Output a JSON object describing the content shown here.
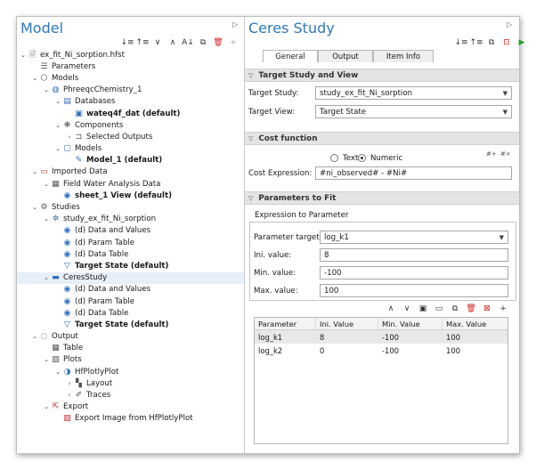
{
  "left": {
    "title": "Model",
    "tree": [
      {
        "indent": 0,
        "caret": "v",
        "icon": "file-icon",
        "glyph": "🗎",
        "label": "ex_fit_Ni_sorption.hfst",
        "bold": false
      },
      {
        "indent": 1,
        "caret": "",
        "icon": "list-icon",
        "glyph": "☰",
        "label": "Parameters",
        "bold": false
      },
      {
        "indent": 1,
        "caret": "v",
        "icon": "cube-icon",
        "glyph": "⬡",
        "label": "Models",
        "bold": false
      },
      {
        "indent": 2,
        "caret": "v",
        "icon": "phreeqc-icon",
        "glyph": "◍",
        "label": "PhreeqcChemistry_1",
        "bold": false
      },
      {
        "indent": 3,
        "caret": "v",
        "icon": "database-icon",
        "glyph": "▤",
        "label": "Databases",
        "bold": false
      },
      {
        "indent": 4,
        "caret": "",
        "icon": "dat-file-icon",
        "glyph": "▣",
        "label": "wateq4f_dat (default)",
        "bold": true
      },
      {
        "indent": 3,
        "caret": "v",
        "icon": "components-icon",
        "glyph": "❋",
        "label": "Components",
        "bold": false
      },
      {
        "indent": 4,
        "caret": ">",
        "icon": "cart-icon",
        "glyph": "⊐",
        "label": "Selected Outputs",
        "bold": false
      },
      {
        "indent": 3,
        "caret": "v",
        "icon": "models-icon",
        "glyph": "▢",
        "label": "Models",
        "bold": false
      },
      {
        "indent": 4,
        "caret": "",
        "icon": "model-edit-icon",
        "glyph": "✎",
        "label": "Model_1 (default)",
        "bold": true
      },
      {
        "indent": 1,
        "caret": "v",
        "icon": "folder-icon",
        "glyph": "▭",
        "label": "Imported Data",
        "bold": false
      },
      {
        "indent": 2,
        "caret": "v",
        "icon": "table-icon",
        "glyph": "▦",
        "label": "Field Water Analysis Data",
        "bold": false
      },
      {
        "indent": 3,
        "caret": "",
        "icon": "view-icon",
        "glyph": "◉",
        "label": "sheet_1 View (default)",
        "bold": true
      },
      {
        "indent": 1,
        "caret": "v",
        "icon": "studies-icon",
        "glyph": "⚙",
        "label": "Studies",
        "bold": false
      },
      {
        "indent": 2,
        "caret": "v",
        "icon": "study-gear-icon",
        "glyph": "✲",
        "label": "study_ex_fit_Ni_sorption",
        "bold": false
      },
      {
        "indent": 3,
        "caret": "",
        "icon": "view-icon",
        "glyph": "◉",
        "label": "(d) Data and Values",
        "bold": false
      },
      {
        "indent": 3,
        "caret": "",
        "icon": "view-icon",
        "glyph": "◉",
        "label": "(d) Param Table",
        "bold": false
      },
      {
        "indent": 3,
        "caret": "",
        "icon": "view-icon",
        "glyph": "◉",
        "label": "(d) Data Table",
        "bold": false
      },
      {
        "indent": 3,
        "caret": "",
        "icon": "target-icon",
        "glyph": "▽",
        "label": "Target State (default)",
        "bold": true
      },
      {
        "indent": 2,
        "caret": "v",
        "icon": "ceres-icon",
        "glyph": "▬",
        "label": "CeresStudy",
        "bold": false,
        "selected": true
      },
      {
        "indent": 3,
        "caret": "",
        "icon": "view-icon",
        "glyph": "◉",
        "label": "(d) Data and Values",
        "bold": false
      },
      {
        "indent": 3,
        "caret": "",
        "icon": "view-icon",
        "glyph": "◉",
        "label": "(d) Param Table",
        "bold": false
      },
      {
        "indent": 3,
        "caret": "",
        "icon": "view-icon",
        "glyph": "◉",
        "label": "(d) Data Table",
        "bold": false
      },
      {
        "indent": 3,
        "caret": "",
        "icon": "target-icon",
        "glyph": "▽",
        "label": "Target State (default)",
        "bold": true
      },
      {
        "indent": 1,
        "caret": "v",
        "icon": "output-icon",
        "glyph": "◌",
        "label": "Output",
        "bold": false
      },
      {
        "indent": 2,
        "caret": "",
        "icon": "table-icon",
        "glyph": "▦",
        "label": "Table",
        "bold": false
      },
      {
        "indent": 2,
        "caret": "v",
        "icon": "plots-icon",
        "glyph": "▧",
        "label": "Plots",
        "bold": false
      },
      {
        "indent": 3,
        "caret": "v",
        "icon": "plotly-icon",
        "glyph": "◑",
        "label": "HfPlotlyPlot",
        "bold": false
      },
      {
        "indent": 4,
        "caret": ">",
        "icon": "layout-icon",
        "glyph": "▚",
        "label": "Layout",
        "bold": false
      },
      {
        "indent": 4,
        "caret": ">",
        "icon": "traces-icon",
        "glyph": "✐",
        "label": "Traces",
        "bold": false
      },
      {
        "indent": 2,
        "caret": "v",
        "icon": "export-icon",
        "glyph": "⇱",
        "label": "Export",
        "bold": false
      },
      {
        "indent": 3,
        "caret": "",
        "icon": "image-icon",
        "glyph": "▨",
        "label": "Export Image from HfPlotlyPlot",
        "bold": false
      }
    ]
  },
  "right": {
    "title": "Ceres Study",
    "tabs": [
      {
        "label": "General",
        "active": true
      },
      {
        "label": "Output",
        "active": false
      },
      {
        "label": "Item Info",
        "active": false
      }
    ],
    "target_section": {
      "header": "Target Study and View",
      "study_label": "Target Study:",
      "study_value": "study_ex_fit_Ni_sorption",
      "view_label": "Target View:",
      "view_value": "Target State"
    },
    "cost_section": {
      "header": "Cost function",
      "radio_text": "Text",
      "radio_numeric": "Numeric",
      "expr_label": "Cost Expression:",
      "expr_value": "#ni_observed# - #Ni#"
    },
    "params_section": {
      "header": "Parameters to Fit",
      "group_title": "Expression to Parameter",
      "target_label": "Parameter target:",
      "target_value": "log_k1",
      "ini_label": "Ini. value:",
      "ini_value": "8",
      "min_label": "Min. value:",
      "min_value": "-100",
      "max_label": "Max. value:",
      "max_value": "100",
      "columns": [
        "Parameter",
        "Ini. Value",
        "Min. Value",
        "Max. Value"
      ],
      "rows": [
        [
          "log_k1",
          "8",
          "-100",
          "100"
        ],
        [
          "log_k2",
          "0",
          "-100",
          "100"
        ]
      ]
    }
  }
}
